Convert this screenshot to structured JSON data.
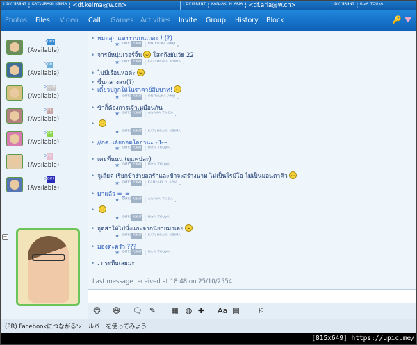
{
  "titlebar": {
    "tabs": [
      "ᴵ ᴰᴵᶠᶠᴲᴿᴲᴺᵀ ¦ ᴷᴬᵀˢᵁᴿᴬᴳᴵ ᴷᴲᴵᴹᴬ ¦ <df.keima@w.cn>",
      "ᴵ ᴰᴵᶠᶠᴲᴿᴲᴺᵀ ¦ ᴷᴬᴺᶻᴬᴷᴵ ᴴ ᴬᴿᴵᴬ ¦ <df.aria@w.cn>",
      "ᴵ ᴰᴵᶠᶠᴲᴿᴲᴺᵀ ¦ ᴿᴵᶻᴬ ᵀᴼᵁᵞᴬ"
    ]
  },
  "menu": {
    "items": [
      "Photos",
      "Files",
      "Video",
      "Call",
      "Games",
      "Activities",
      "Invite",
      "Group",
      "History",
      "Block"
    ],
    "dim": [
      true,
      false,
      true,
      false,
      true,
      true,
      false,
      false,
      false,
      false
    ],
    "tools": [
      "🔑",
      "♥"
    ]
  },
  "roster": [
    {
      "name": "ᴰ",
      "tag": "ᴰᴵᶠᶠ",
      "tag_color": "#3a8ed4",
      "status": "(Available)",
      "avatar": "#6d8b5b"
    },
    {
      "name": "ᴰ",
      "tag": "ᴳᴿ",
      "tag_color": "#6fb0d8",
      "status": "(Available)",
      "avatar": "#3f6c98"
    },
    {
      "name": "ᴰ",
      "tag": "ᴳᴬᴹ",
      "tag_color": "#c9c9c9",
      "status": "(Available)",
      "avatar": "#d8c080"
    },
    {
      "name": "ᴰ",
      "tag": "ᴿᴱ",
      "tag_color": "#c7a7a7",
      "status": "(Available)",
      "avatar": "#b48080"
    },
    {
      "name": "ᴰ",
      "tag": "ᴳᴿ",
      "tag_color": "#8ad64b",
      "status": "(Available)",
      "avatar": "#d87cb0"
    },
    {
      "name": "ᴰ",
      "tag": "ᴿᴱ",
      "tag_color": "#e6c0d0",
      "status": "(Available)",
      "avatar": "#e3cba8"
    },
    {
      "name": "ᴰ",
      "tag": "ᴰᴵᶠᶠ",
      "tag_color": "#2a2ab8",
      "status": "(Available)",
      "avatar": "#5876b4"
    }
  ],
  "chat": {
    "lines": [
      {
        "kind": "msg",
        "text": "หมอสุก แดงงานกนเถอะ ! (?)",
        "smiley": false
      },
      {
        "kind": "sig",
        "a": "ᴰᴵᶠᶠᴲ",
        "b": "ᴿᴲᴺᵀ",
        "c": " ¦ ᴼᴺᴵᵀˢᵁᴷᴬ ᴬᴷᴵᴶᴵ ,"
      },
      {
        "kind": "msg",
        "text": "จารย์หนุ่มเวอร์จิ้น",
        "smiley": true,
        "after": " โสดถึงยันวัย 22"
      },
      {
        "kind": "sig",
        "a": "ᴰᴵᶠᶠᴲ",
        "b": "ᴿᴲᴺᵀ",
        "c": " ¦ ᴷᴬᵀˢᵁᴿᴬᴳᴵ ᴷᴲᴵᴹᴬ ,"
      },
      {
        "kind": "msg",
        "text": "ไม่มีเรือนหอด่ะ",
        "smiley": true,
        "after": ""
      },
      {
        "kind": "msg",
        "text": "ขึ้นกลางสน(?)",
        "smiley": false
      },
      {
        "kind": "msg",
        "text": "เดี๋ยวปลูกให้ในราคาย์สิบบาท!",
        "smiley": true,
        "after": ""
      },
      {
        "kind": "sig",
        "a": "ᴰᴵᶠᶠᴲ",
        "b": "ᴿᴲᴺᵀ",
        "c": " ¦ ᴼᴺᴵᵀˢᵁᴷᴬ ᴬᴷᴵᴶᴵ ,"
      },
      {
        "kind": "msg",
        "text": "ข้าก็ต้องการเจ้าเหมือนกัน",
        "smiley": false
      },
      {
        "kind": "sig",
        "a": "ᴰᴵᶠᶠᴲ",
        "b": "ᴿᴲᴺᵀ",
        "c": " ¦ ᴬᴵˢᴬᴷᴬ ᵀᴬᴵᴳᴬ ,"
      },
      {
        "kind": "msg",
        "text": "",
        "smiley": true,
        "after": ""
      },
      {
        "kind": "sig",
        "a": "ᴰᴵᶠᶠᴲ",
        "b": "ᴿᴲᴺᵀ",
        "c": " ¦ ᴷᴬᵀˢᵁᴿᴬᴳᴵ ᴷᴲᴵᴹᴬ ,"
      },
      {
        "kind": "msg",
        "text": "//กค..เอ้ยกอดโอฮานะ -3-~",
        "smiley": false
      },
      {
        "kind": "sig",
        "a": "ᴰᴵᶠᶠᴲ",
        "b": "ᴿᴲᴺᵀ",
        "c": " ¦ ᴿᴵᶻᴬ ᵀᴼᵁᵞᴬ ,"
      },
      {
        "kind": "msg",
        "text": "เคยที่นนน (ดูแคปละ)",
        "smiley": false
      },
      {
        "kind": "sig",
        "a": "ᴰᴵᶠᶠᴲ",
        "b": "ᴿᴲᴺᵀ",
        "c": " ¦ ᴿᴵᶻᴬ ᵀᴼᵁᵞᴬ ,"
      },
      {
        "kind": "msg",
        "text": "จูเลียต เรียกข้าง่ายอลรักและข้าจะสร้างนาม ไม่เป็นโรมิโอ ไม่เป็นมอนตาคิว",
        "smiley": true,
        "after": ""
      },
      {
        "kind": "sig",
        "a": "ᴰᴵᶠᶠᴲ",
        "b": "ᴿᴲᴺᵀ",
        "c": " ¦ ᴷᴬᴺᶻᴬᴷᴵ ᴴ ᴬᴿᴵᴬ ,"
      },
      {
        "kind": "msg",
        "text": "มาแล้ว =_=;",
        "smiley": false
      },
      {
        "kind": "sig",
        "a": "ᴰᴵᶠᶠᴲ",
        "b": "ᴿᴲᴺᵀ",
        "c": " ¦ ᴬᴵˢᴬᴷᴬ ᵀᴬᴵᴳᴬ ,"
      },
      {
        "kind": "msg",
        "text": "",
        "smiley": true,
        "after": ""
      },
      {
        "kind": "sig",
        "a": "ᴰᴵᶠᶠᴲ",
        "b": "ᴿᴲᴺᵀ",
        "c": " ¦ ᴿᴵᶻᴬ ᵀᴼᵁᵞᴬ ,"
      },
      {
        "kind": "msg",
        "text": "อุดส่าให้ไปนั่งแกะจากนิยายมาเลย",
        "smiley": true,
        "after": ""
      },
      {
        "kind": "sig",
        "a": "ᴰᴵᶠᶠᴲ",
        "b": "ᴿᴲᴺᵀ",
        "c": " ¦ ᴷᴬᵀˢᵁᴿᴬᴳᴵ ᴷᴲᴵᴹᴬ ,"
      },
      {
        "kind": "msg",
        "text": "มองตะครัว ???",
        "smiley": false
      },
      {
        "kind": "sig",
        "a": "ᴰᴵᶠᶠᴲ",
        "b": "ᴿᴲᴺᵀ",
        "c": " ¦ ᴿᴵᶻᴬ ᵀᴼᵁᵞᴬ ,"
      },
      {
        "kind": "msg",
        "text": ". กระทืบเลยมะ",
        "smiley": false
      }
    ],
    "last_message": "Last message received at 18:48 on 25/10/2554."
  },
  "formatbar": {
    "icons": [
      "😊",
      "😄",
      "🗨",
      "✎",
      "▦",
      "◍",
      "✚",
      "Aa",
      "▤",
      "⚐"
    ]
  },
  "status": {
    "ad": "(PR) Facebookにつながるツールバーを使ってみよう"
  },
  "watermark": "[815x649] https://upic.me/"
}
